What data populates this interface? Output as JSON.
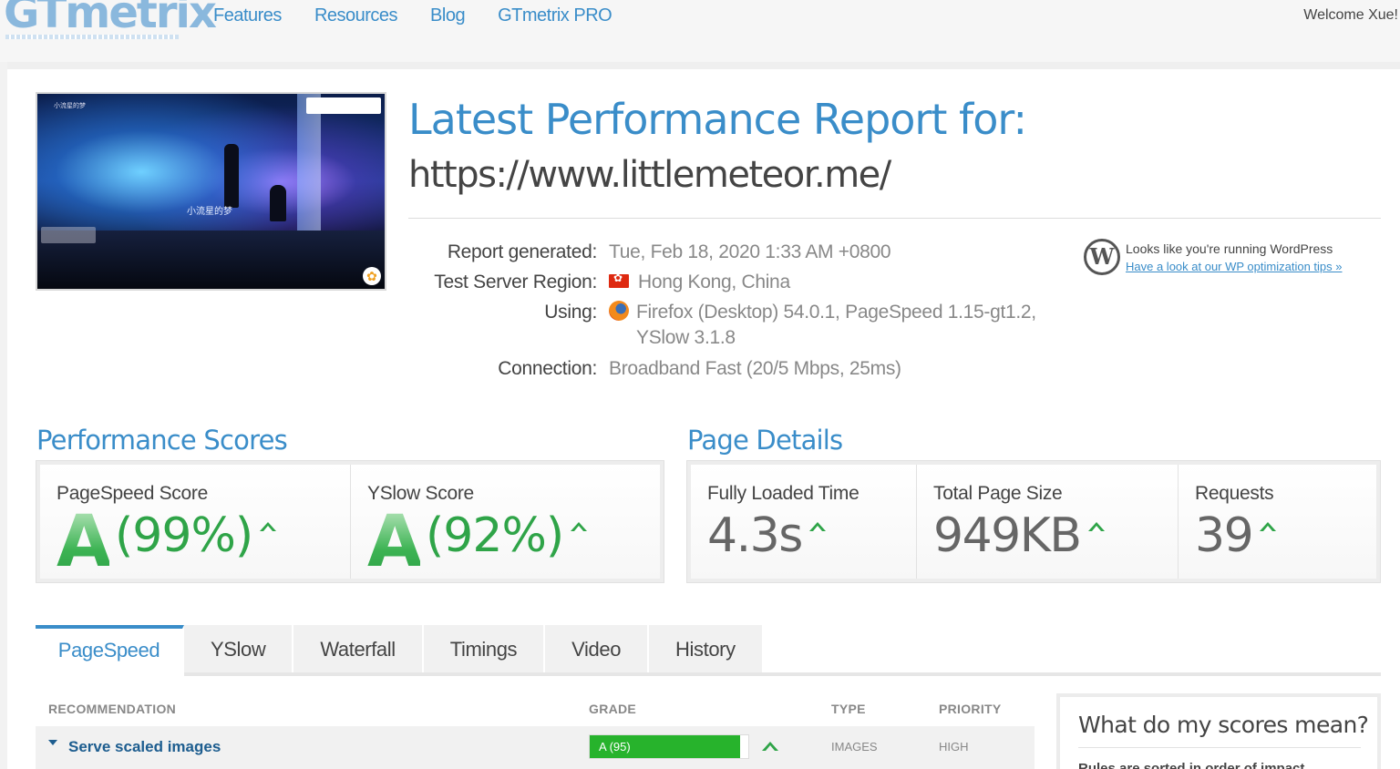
{
  "header": {
    "logo": "GTmetrix",
    "nav": [
      "Features",
      "Resources",
      "Blog",
      "GTmetrix PRO"
    ],
    "welcome": "Welcome Xue!"
  },
  "thumbnail": {
    "caption": "小流星的梦",
    "corner_label": "小流星的梦"
  },
  "report": {
    "title": "Latest Performance Report for:",
    "url": "https://www.littlemeteor.me/",
    "rows": [
      {
        "key": "Report generated:",
        "value": "Tue, Feb 18, 2020 1:33 AM +0800"
      },
      {
        "key": "Test Server Region:",
        "value": "Hong Kong, China",
        "icon": "hong-kong-flag-icon"
      },
      {
        "key": "Using:",
        "value": "Firefox (Desktop) 54.0.1, PageSpeed 1.15-gt1.2,",
        "value2": "YSlow 3.1.8",
        "icon": "firefox-icon"
      },
      {
        "key": "Connection:",
        "value": "Broadband Fast (20/5 Mbps, 25ms)"
      }
    ]
  },
  "wordpress": {
    "text": "Looks like you're running WordPress",
    "link": "Have a look at our WP optimization tips »"
  },
  "performance": {
    "title": "Performance Scores",
    "pagespeed": {
      "label": "PageSpeed Score",
      "grade": "A",
      "percent": "(99%)"
    },
    "yslow": {
      "label": "YSlow Score",
      "grade": "A",
      "percent": "(92%)"
    }
  },
  "details": {
    "title": "Page Details",
    "fully_loaded": {
      "label": "Fully Loaded Time",
      "value": "4.3s"
    },
    "page_size": {
      "label": "Total Page Size",
      "value": "949KB"
    },
    "requests": {
      "label": "Requests",
      "value": "39"
    }
  },
  "tabs": [
    "PageSpeed",
    "YSlow",
    "Waterfall",
    "Timings",
    "Video",
    "History"
  ],
  "table": {
    "headers": {
      "recommendation": "RECOMMENDATION",
      "grade": "GRADE",
      "type": "TYPE",
      "priority": "PRIORITY"
    },
    "rows": [
      {
        "name": "Serve scaled images",
        "grade": "A (95)",
        "grade_value": 95,
        "type": "IMAGES",
        "priority": "HIGH"
      }
    ]
  },
  "sidebox": {
    "title": "What do my scores mean?",
    "subtitle": "Rules are sorted in order of impact"
  },
  "colors": {
    "accent": "#3a8dc9",
    "grade_green": "#2fa448",
    "bar_green": "#27b32c"
  }
}
